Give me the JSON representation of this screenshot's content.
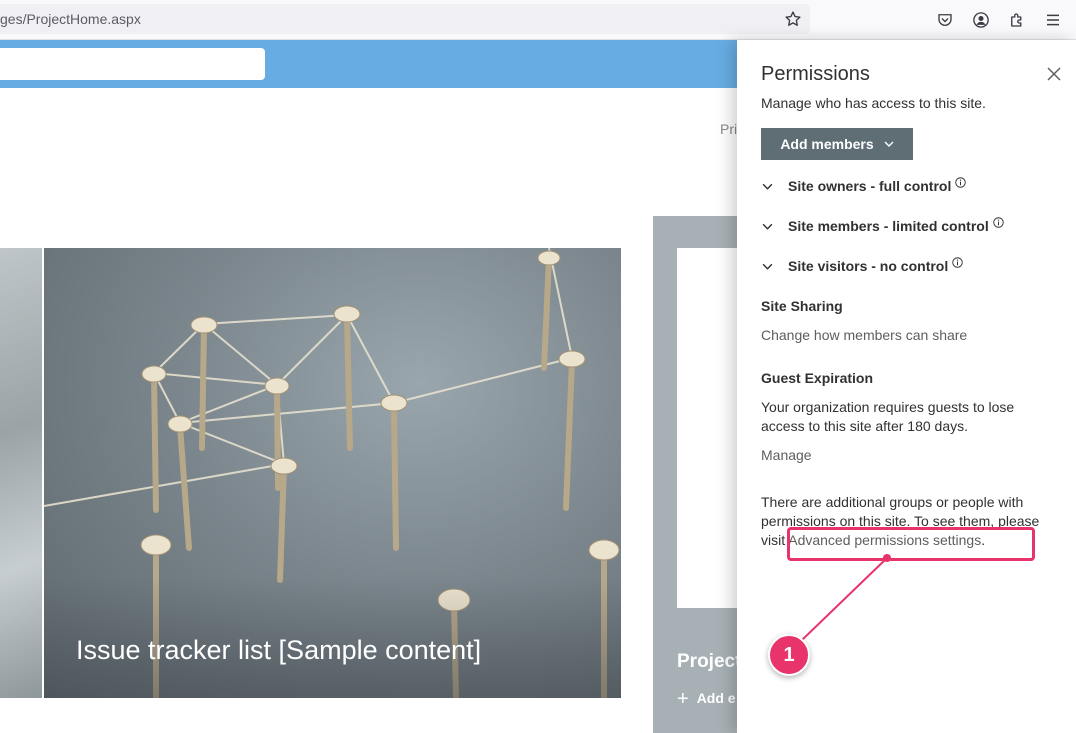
{
  "browser": {
    "url": "ges/ProjectHome.aspx"
  },
  "page": {
    "nav_partial": "Pri",
    "tile_main_title": "Issue tracker list [Sample content]",
    "tile_right_title": "Project",
    "tile_right_add": "Add e"
  },
  "panel": {
    "title": "Permissions",
    "description": "Manage who has access to this site.",
    "add_members_label": "Add members",
    "groups": [
      {
        "label": "Site owners - full control"
      },
      {
        "label": "Site members - limited control"
      },
      {
        "label": "Site visitors - no control"
      }
    ],
    "site_sharing": {
      "heading": "Site Sharing",
      "link": "Change how members can share"
    },
    "guest_expiration": {
      "heading": "Guest Expiration",
      "text": "Your organization requires guests to lose access to this site after 180 days.",
      "link": "Manage"
    },
    "additional": {
      "text_before": "There are additional groups or people with permissions on this site. To see them, please visit ",
      "link": "Advanced permissions settings",
      "text_after": "."
    }
  },
  "annotation": {
    "badge": "1",
    "color": "#e8336b"
  },
  "colors": {
    "suite_bar": "#67ade4",
    "add_members_bg": "#5e6e74"
  }
}
